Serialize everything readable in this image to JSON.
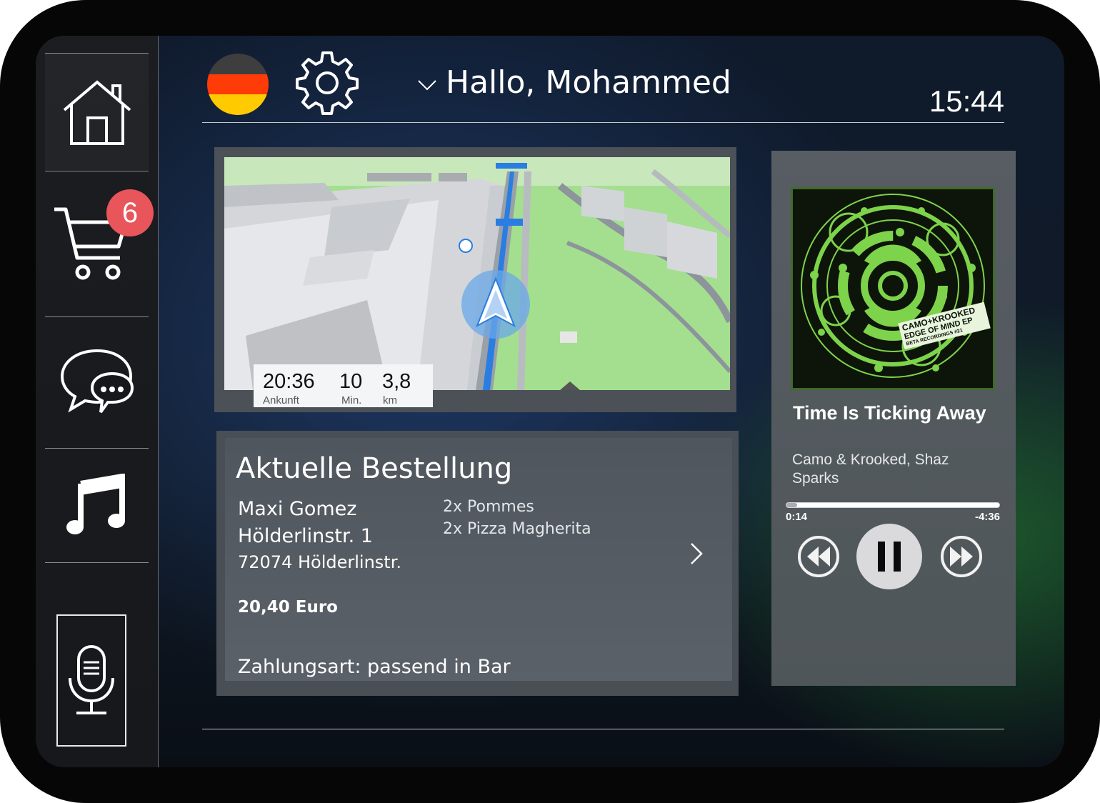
{
  "header": {
    "greeting": "Hallo, Mohammed",
    "time": "15:44",
    "language_flag": "germany-flag",
    "settings_icon": "gear-icon"
  },
  "sidebar": {
    "items": [
      {
        "id": "home",
        "icon": "home-icon",
        "active": true
      },
      {
        "id": "cart",
        "icon": "cart-icon",
        "badge": "6"
      },
      {
        "id": "messages",
        "icon": "chat-bubbles-icon"
      },
      {
        "id": "music",
        "icon": "music-note-icon"
      },
      {
        "id": "voice",
        "icon": "microphone-icon"
      }
    ],
    "cart_badge": "6"
  },
  "navigation": {
    "eta": {
      "arrival": "20:36",
      "arrival_label": "Ankunft",
      "duration": "10",
      "duration_label": "Min.",
      "distance": "3,8",
      "distance_label": "km"
    }
  },
  "order": {
    "title": "Aktuelle Bestellung",
    "customer_name": "Maxi Gomez",
    "street": "Hölderlinstr. 1",
    "city": "72074 Hölderlinstr.",
    "items": [
      "2x Pommes",
      "2x Pizza Magherita"
    ],
    "total": "20,40 Euro",
    "payment": "Zahlungsart:  passend in Bar"
  },
  "music": {
    "title": "Time Is Ticking Away",
    "artist": "Camo & Krooked, Shaz Sparks",
    "elapsed": "0:14",
    "remaining": "-4:36",
    "progress": 0.05,
    "album_art_text": [
      "CAMO+KROOKED",
      "EDGE OF MIND EP",
      "BETA RECORDINGS #21"
    ],
    "state": "playing"
  },
  "colors": {
    "badge": "#e8555b",
    "route": "#2a7de1",
    "map_green": "#9edc8a",
    "album_green": "#7dd34a"
  }
}
